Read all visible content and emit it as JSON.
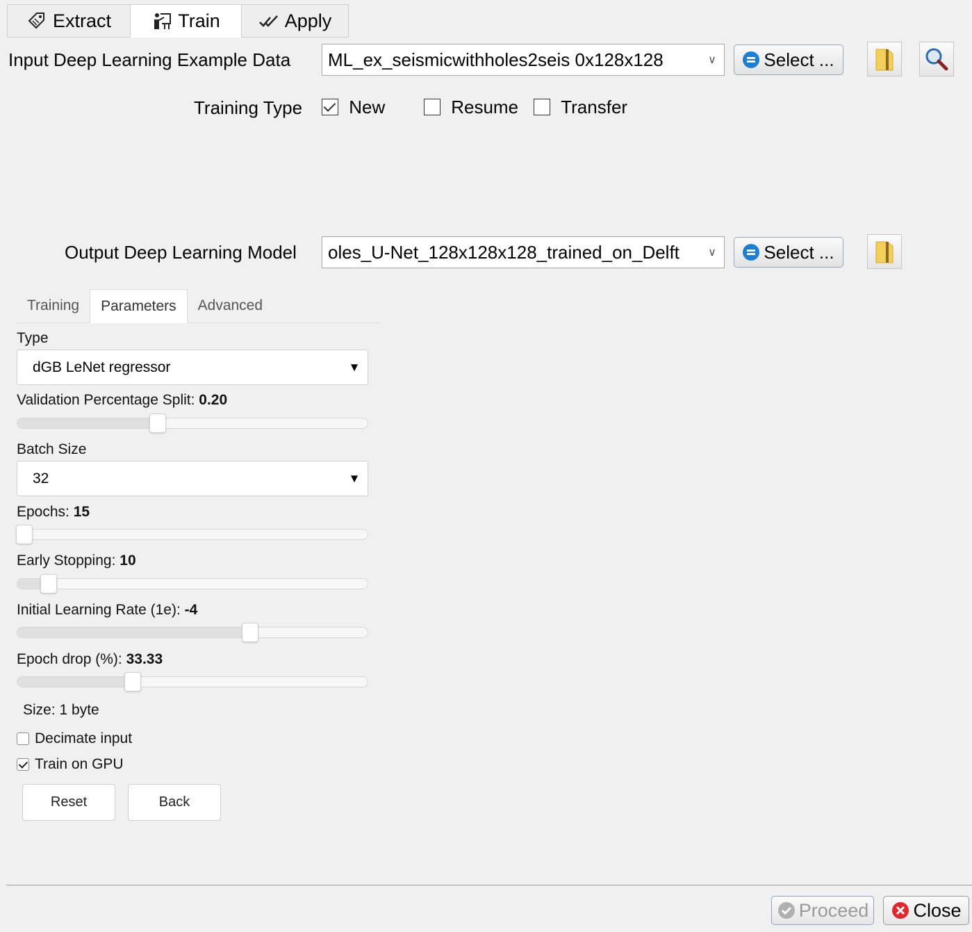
{
  "tabs": [
    {
      "label": "Extract",
      "icon": "tag-icon"
    },
    {
      "label": "Train",
      "icon": "train-icon"
    },
    {
      "label": "Apply",
      "icon": "apply-icon"
    }
  ],
  "input": {
    "label": "Input Deep Learning Example Data",
    "value": "ML_ex_seismicwithholes2seis 0x128x128",
    "select_label": "Select ..."
  },
  "training_type": {
    "label": "Training Type",
    "options": [
      {
        "label": "New",
        "checked": true
      },
      {
        "label": "Resume",
        "checked": false
      },
      {
        "label": "Transfer",
        "checked": false
      }
    ]
  },
  "output": {
    "label": "Output Deep Learning Model",
    "value": "oles_U-Net_128x128x128_trained_on_Delft",
    "select_label": "Select ..."
  },
  "params": {
    "tabs": [
      "Training",
      "Parameters",
      "Advanced"
    ],
    "type_label": "Type",
    "type_value": "dGB LeNet regressor",
    "validation_label": "Validation Percentage Split:",
    "validation_value": "0.20",
    "validation_level": 0.4,
    "batch_label": "Batch Size",
    "batch_value": "32",
    "epochs_label": "Epochs:",
    "epochs_value": "15",
    "epochs_level": 0.02,
    "early_label": "Early Stopping:",
    "early_value": "10",
    "early_level": 0.09,
    "lr_label": "Initial Learning Rate (1e):",
    "lr_value": "-4",
    "lr_level": 0.665,
    "drop_label": "Epoch drop (%):",
    "drop_value": "33.33",
    "drop_level": 0.33,
    "size_text": "Size: 1 byte",
    "decimate_label": "Decimate input",
    "decimate_checked": false,
    "gpu_label": "Train on GPU",
    "gpu_checked": true,
    "reset_label": "Reset",
    "back_label": "Back"
  },
  "footer": {
    "proceed_label": "Proceed",
    "close_label": "Close"
  },
  "colors": {
    "accent": "#1b7fd6",
    "close": "#e0282e",
    "proceed_disabled": "#9a9a9a"
  }
}
